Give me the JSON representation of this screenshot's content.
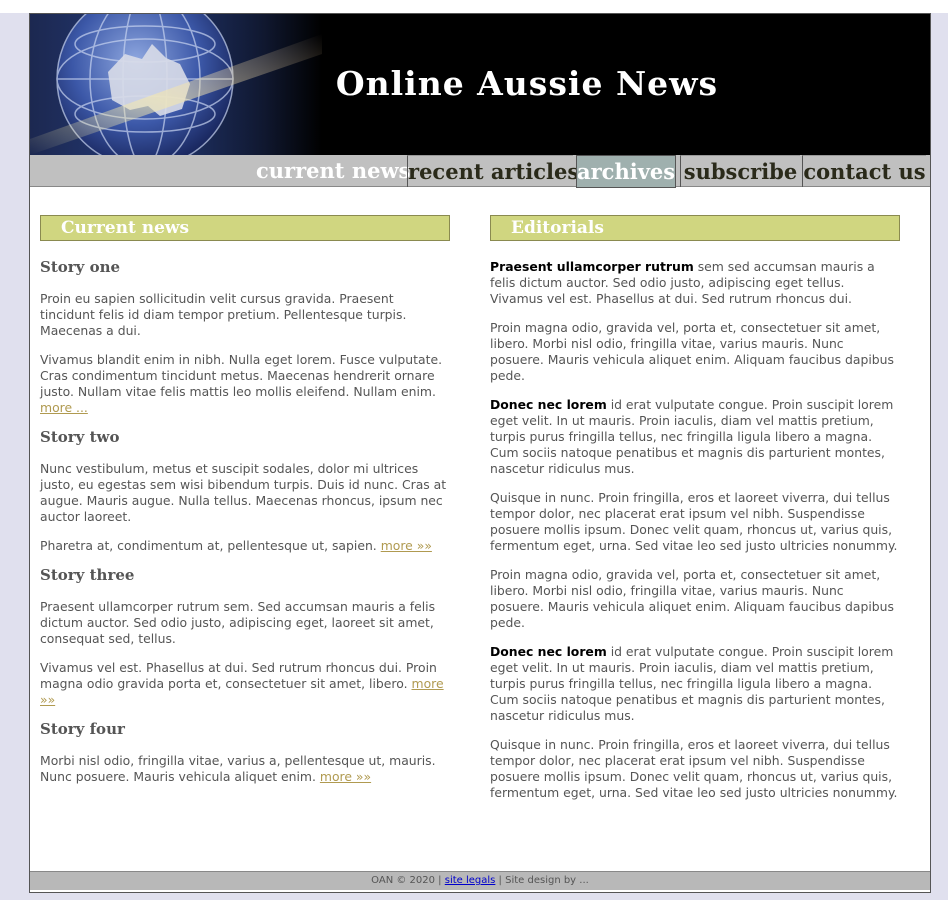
{
  "header": {
    "title": "Online Aussie News"
  },
  "nav": {
    "items": [
      "current news",
      "recent articles",
      "archives",
      "subscribe",
      "contact us"
    ]
  },
  "left": {
    "heading": "Current news",
    "stories": [
      {
        "title": "Story one",
        "p1": "Proin eu sapien sollicitudin velit cursus gravida. Praesent tincidunt felis id diam tempor pretium. Pellentesque turpis. Maecenas a dui.",
        "p2": "Vivamus blandit enim in nibh. Nulla eget lorem. Fusce vulputate. Cras condimentum tincidunt metus. Maecenas hendrerit ornare justo. Nullam vitae felis mattis leo mollis eleifend. Nullam enim.",
        "more": "more ..."
      },
      {
        "title": "Story two",
        "p1": "Nunc vestibulum, metus et suscipit sodales, dolor mi ultrices justo, eu egestas sem wisi bibendum turpis. Duis id nunc. Cras at augue. Mauris augue. Nulla tellus. Maecenas rhoncus, ipsum nec auctor laoreet.",
        "p2": "Pharetra at, condimentum at, pellentesque ut, sapien.",
        "more": "more »»"
      },
      {
        "title": "Story three",
        "p1": "Praesent ullamcorper rutrum sem. Sed accumsan mauris a felis dictum auctor. Sed odio justo, adipiscing eget, laoreet sit amet, consequat sed, tellus.",
        "p2": "Vivamus vel est. Phasellus at dui. Sed rutrum rhoncus dui. Proin magna odio gravida porta et, consectetuer sit amet, libero.",
        "more": "more »»"
      },
      {
        "title": "Story four",
        "p1": "Morbi nisl odio, fringilla vitae, varius a, pellentesque ut, mauris. Nunc posuere. Mauris vehicula aliquet enim.",
        "more": "more »»"
      }
    ]
  },
  "right": {
    "heading": "Editorials",
    "e1_bold": "Praesent ullamcorper rutrum",
    "e1_text": " sem sed accumsan mauris a felis dictum auctor. Sed odio justo, adipiscing eget tellus. Vivamus vel est. Phasellus at dui. Sed rutrum rhoncus dui.",
    "e2": "Proin magna odio, gravida vel, porta et, consectetuer sit amet, libero. Morbi nisl odio, fringilla vitae, varius mauris. Nunc posuere. Mauris vehicula aliquet enim. Aliquam faucibus dapibus pede.",
    "e3_bold": "Donec nec lorem",
    "e3_text": " id erat vulputate congue. Proin suscipit lorem eget velit. In ut mauris. Proin iaculis, diam vel mattis pretium, turpis purus fringilla tellus, nec fringilla ligula libero a magna. Cum sociis natoque penatibus et magnis dis parturient montes, nascetur ridiculus mus.",
    "e4": "Quisque in nunc. Proin fringilla, eros et laoreet viverra, dui tellus tempor dolor, nec placerat erat ipsum vel nibh. Suspendisse posuere mollis ipsum. Donec velit quam, rhoncus ut, varius quis, fermentum eget, urna. Sed vitae leo sed justo ultricies nonummy.",
    "e5": "Proin magna odio, gravida vel, porta et, consectetuer sit amet, libero. Morbi nisl odio, fringilla vitae, varius mauris. Nunc posuere. Mauris vehicula aliquet enim. Aliquam faucibus dapibus pede.",
    "e6_bold": "Donec nec lorem",
    "e6_text": " id erat vulputate congue. Proin suscipit lorem eget velit. In ut mauris. Proin iaculis, diam vel mattis pretium, turpis purus fringilla tellus, nec fringilla ligula libero a magna. Cum sociis natoque penatibus et magnis dis parturient montes, nascetur ridiculus mus.",
    "e7": "Quisque in nunc. Proin fringilla, eros et laoreet viverra, dui tellus tempor dolor, nec placerat erat ipsum vel nibh. Suspendisse posuere mollis ipsum. Donec velit quam, rhoncus ut, varius quis, fermentum eget, urna. Sed vitae leo sed justo ultricies nonummy."
  },
  "footer": {
    "prefix": "OAN © 2020 | ",
    "link": "site legals",
    "suffix": " | Site design by ..."
  },
  "colors": {
    "heading_bar": "#d0d680",
    "more_link": "#b09a50",
    "nav_active": "#9fb0ae",
    "nav_bar": "#c0c0c0",
    "page_bg": "#e0e0ee"
  }
}
